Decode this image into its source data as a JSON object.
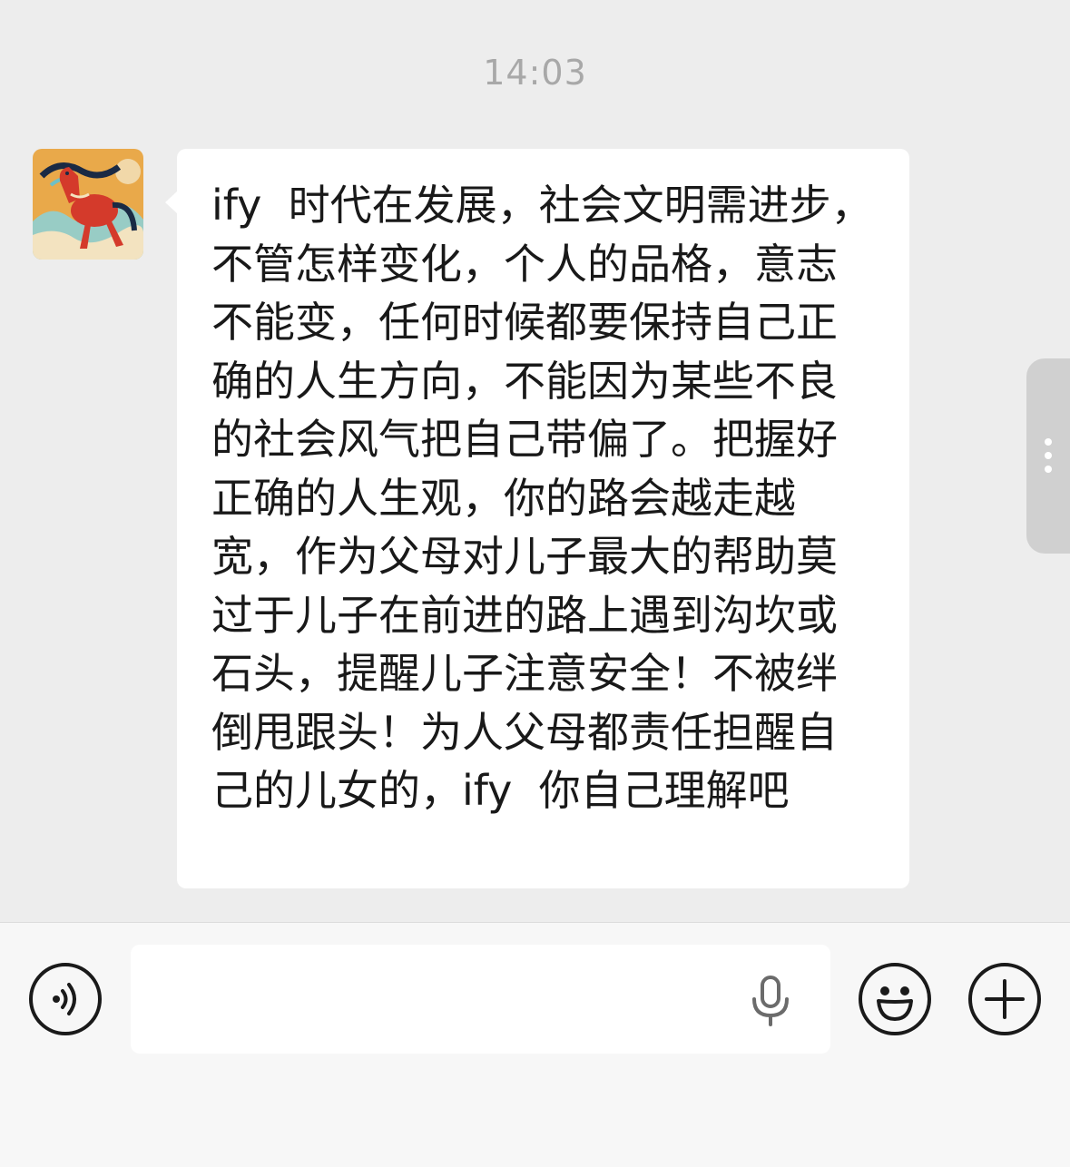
{
  "chat": {
    "timestamp": "14:03",
    "messages": [
      {
        "sender": "other",
        "text": "ify  时代在发展，社会文明需进步，不管怎样变化，个人的品格，意志不能变，任何时候都要保持自己正确的人生方向，不能因为某些不良的社会风气把自己带偏了。把握好正确的人生观，你的路会越走越宽，作为父母对儿子最大的帮助莫过于儿子在前进的路上遇到沟坎或石头，提醒儿子注意安全！不被绊倒甩跟头！为人父母都责任担醒自己的儿女的，ify  你自己理解吧"
      }
    ]
  },
  "input_bar": {
    "input_value": "",
    "icons": {
      "voice_toggle": "voice-icon",
      "mic": "mic-icon",
      "emoji": "emoji-icon",
      "more": "plus-icon"
    }
  },
  "colors": {
    "chat_background": "#ededed",
    "bubble": "#ffffff",
    "text": "#191919",
    "timestamp": "#a8a8a8",
    "input_bar": "#f7f7f7"
  }
}
